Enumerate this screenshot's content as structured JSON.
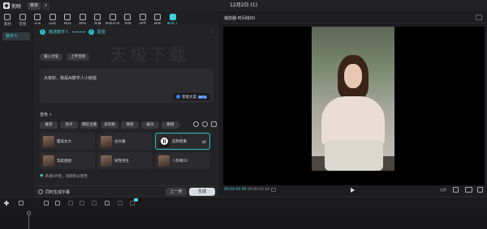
{
  "window": {
    "app_name": "剪映",
    "menu_label": "菜单",
    "title": "12月2日 (1)"
  },
  "toolbar": {
    "items": [
      {
        "label": "素材",
        "icon": "media-icon",
        "active": false
      },
      {
        "label": "音频",
        "icon": "audio-icon",
        "active": false
      },
      {
        "label": "文本",
        "icon": "text-icon",
        "active": false
      },
      {
        "label": "贴纸",
        "icon": "sticker-icon",
        "active": false
      },
      {
        "label": "特效",
        "icon": "effects-icon",
        "active": false
      },
      {
        "label": "转场",
        "icon": "transition-icon",
        "active": false
      },
      {
        "label": "字幕",
        "icon": "subtitle-icon",
        "active": false
      },
      {
        "label": "智能包装",
        "icon": "smart-pack-icon",
        "active": false
      },
      {
        "label": "滤镜",
        "icon": "filter-icon",
        "active": false
      },
      {
        "label": "调节",
        "icon": "adjust-icon",
        "active": false
      },
      {
        "label": "模板",
        "icon": "template-icon",
        "active": false
      },
      {
        "label": "数字人",
        "icon": "digital-human-icon",
        "active": true
      }
    ]
  },
  "sidebar": {
    "items": [
      {
        "label": "数字人"
      }
    ]
  },
  "wizard": {
    "step1": {
      "num": "1",
      "label": "挑选数字人"
    },
    "step2": {
      "num": "2",
      "label": "配音"
    },
    "watermark": "天极下载",
    "tabs": [
      "输入文案",
      "上传音频"
    ],
    "script_text": "大家好，我是AI数字人小晓姐",
    "smart_btn": {
      "label": "智能文案",
      "badge": "BETA"
    },
    "voice_title": "音色",
    "voice_categories": [
      "推荐",
      "男声",
      "网红主播",
      "多风格",
      "情感",
      "娱乐",
      "剧情"
    ],
    "voices": [
      {
        "name": "甜美女大",
        "selected": false
      },
      {
        "name": "古文雅",
        "selected": false
      },
      {
        "name": "成熟稳重",
        "selected": true
      },
      {
        "name": "温柔姐姐",
        "selected": false
      },
      {
        "name": "知性男生",
        "selected": false
      },
      {
        "name": "八卦聊22",
        "selected": false
      }
    ],
    "tip": "开通VIP后，消耗积分使用",
    "sync_label": "同时生成字幕",
    "prev_label": "上一步",
    "generate_label": "生成"
  },
  "player": {
    "title": "播放器-时间线00",
    "timecode_current": "00:00:00:00",
    "timecode_total": "00:00:02:02",
    "ratio_label": "比例"
  },
  "timeline": {
    "ai_badge": "AI"
  }
}
